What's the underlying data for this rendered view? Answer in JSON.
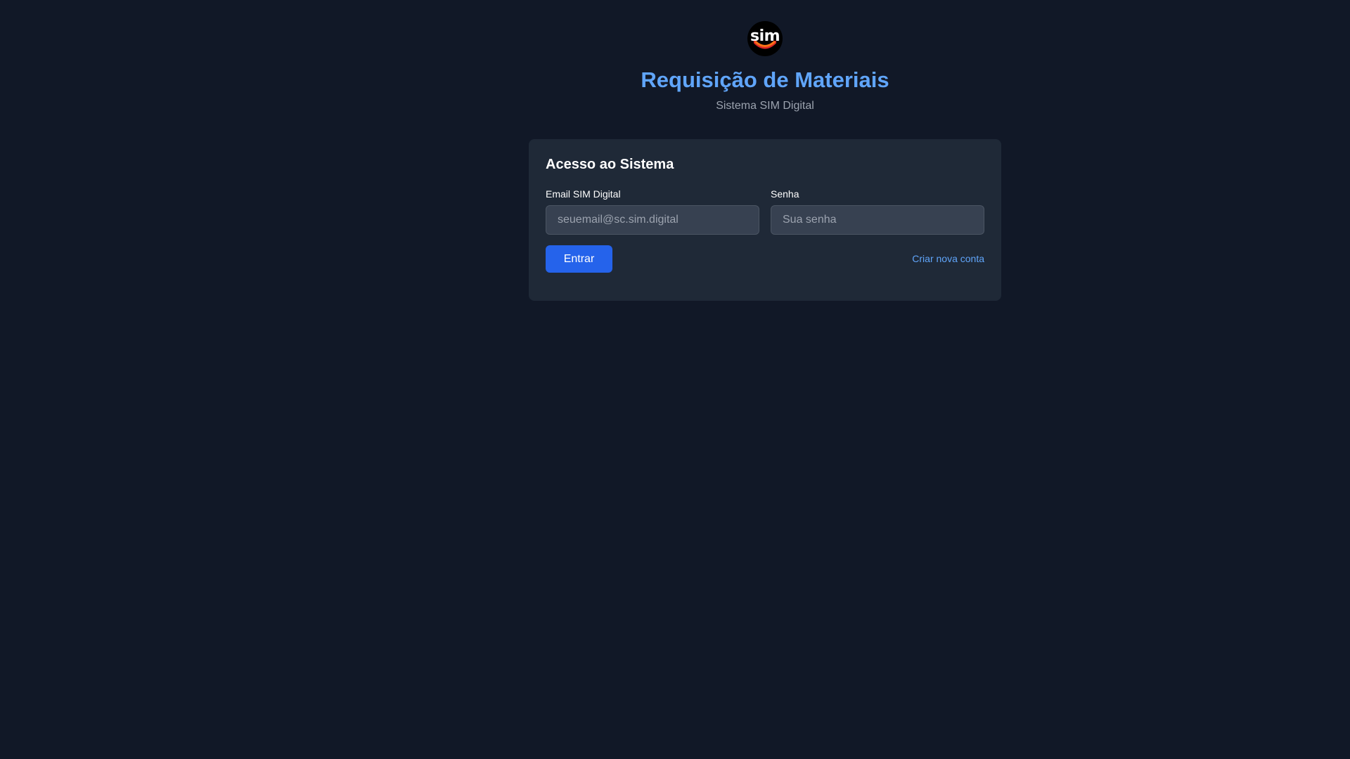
{
  "logo": {
    "text": "sim",
    "smile_color": "#f97316",
    "smile_color_secondary": "#dc2626"
  },
  "header": {
    "title": "Requisição de Materiais",
    "subtitle": "Sistema SIM Digital"
  },
  "login_card": {
    "title": "Acesso ao Sistema",
    "email": {
      "label": "Email SIM Digital",
      "placeholder": "seuemail@sc.sim.digital",
      "value": ""
    },
    "password": {
      "label": "Senha",
      "placeholder": "Sua senha",
      "value": ""
    },
    "submit_label": "Entrar",
    "create_account_label": "Criar nova conta"
  },
  "colors": {
    "background": "#111827",
    "card": "#1f2937",
    "accent": "#60a5fa",
    "primary_button": "#2563eb"
  }
}
